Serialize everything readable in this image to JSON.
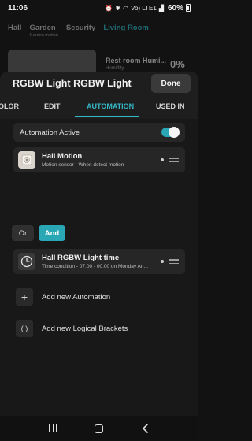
{
  "status_bar": {
    "time": "11:06",
    "network": "Vo) LTE1",
    "battery": "60%"
  },
  "background": {
    "tabs": [
      {
        "label": "Hall",
        "sub": ""
      },
      {
        "label": "Garden",
        "sub": "Garden motion"
      },
      {
        "label": "Security",
        "sub": ""
      },
      {
        "label": "Living Room",
        "sub": ""
      }
    ],
    "active_tab": "Living Room",
    "card_title": "Rest room Humi...",
    "card_sub": "Humidity",
    "card_value": "0%"
  },
  "sheet": {
    "title": "RGBW Light RGBW Light",
    "done_label": "Done",
    "tabs": [
      {
        "label": "OLOR"
      },
      {
        "label": "EDIT"
      },
      {
        "label": "AUTOMATION"
      },
      {
        "label": "USED IN"
      }
    ],
    "active_tab": "AUTOMATION",
    "automation_active_label": "Automation Active",
    "automation_active": true,
    "items": [
      {
        "title": "Hall Motion",
        "subtitle": "Motion sensor - When detect motion",
        "icon": "motion-sensor-icon"
      },
      {
        "title": "Hall RGBW Light time",
        "subtitle": "Time condition - 07:00 - 00:00 on Monday An...",
        "icon": "clock-icon"
      }
    ],
    "logic": {
      "or_label": "Or",
      "and_label": "And",
      "selected": "And"
    },
    "add_automation_label": "Add new Automation",
    "add_brackets_label": "Add new Logical Brackets",
    "add_icon": "+",
    "brackets_icon": "( )"
  },
  "colors": {
    "accent": "#2aa7b5",
    "background": "#121212",
    "card": "#262626"
  }
}
